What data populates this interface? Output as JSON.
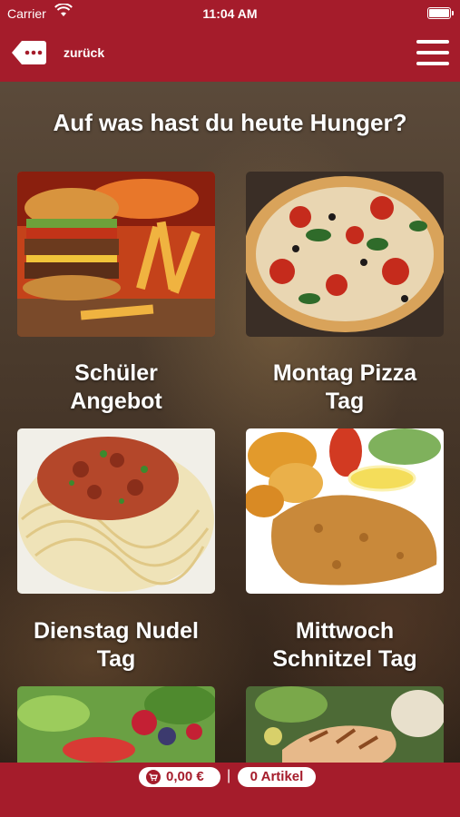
{
  "status_bar": {
    "carrier": "Carrier",
    "time": "11:04 AM"
  },
  "nav": {
    "back_label": "zurück"
  },
  "headline": "Auf was hast du heute Hunger?",
  "tiles": [
    {
      "label": "Schüler\nAngebot",
      "image": "burger-fries"
    },
    {
      "label": "Montag Pizza\nTag",
      "image": "pizza"
    },
    {
      "label": "Dienstag Nudel\nTag",
      "image": "spaghetti-bolognese"
    },
    {
      "label": "Mittwoch\nSchnitzel Tag",
      "image": "schnitzel-potatoes"
    },
    {
      "label": "",
      "image": "salad-strawberries"
    },
    {
      "label": "",
      "image": "grilled-chicken-salad"
    }
  ],
  "cart": {
    "total": "0,00 €",
    "separator": "|",
    "count": "0 Artikel"
  },
  "colors": {
    "brand": "#a51c2b",
    "text": "#ffffff"
  }
}
